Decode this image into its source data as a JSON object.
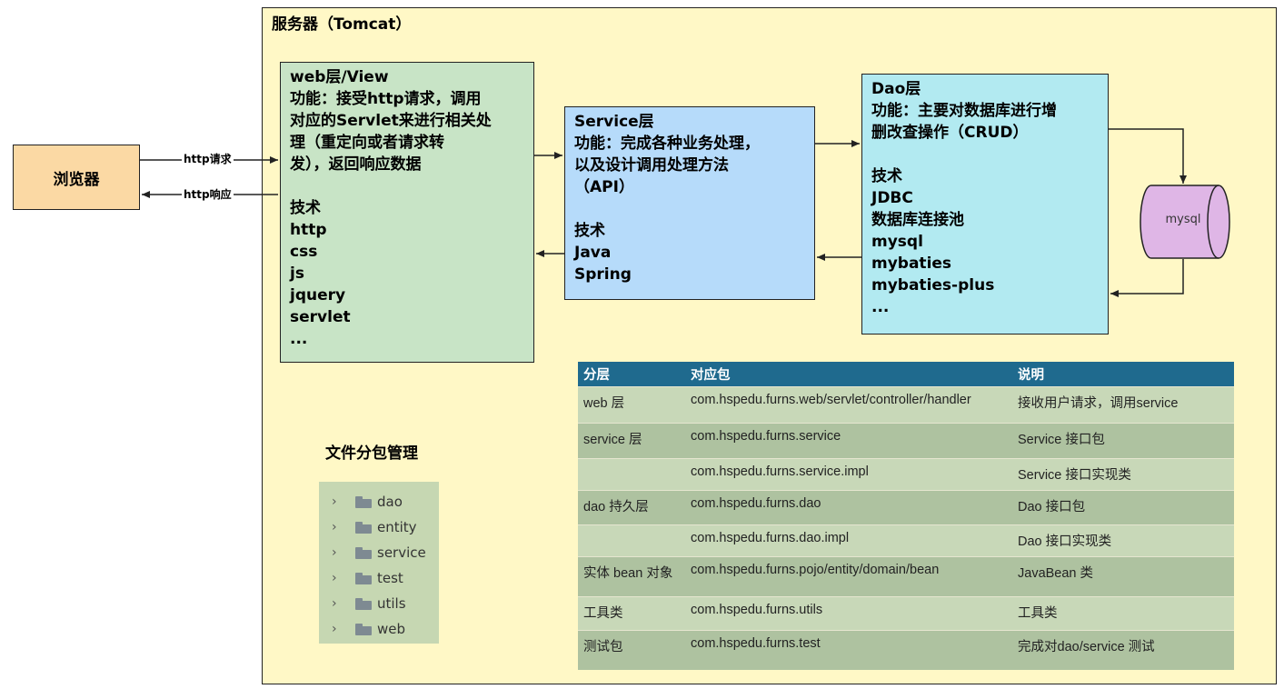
{
  "server": {
    "title": "服务器（Tomcat）"
  },
  "browser": {
    "label": "浏览器"
  },
  "arrows": {
    "http_request": "http请求",
    "http_response": "http响应"
  },
  "web_box": {
    "lines": [
      "web层/View",
      "功能：接受http请求，调用",
      "对应的Servlet来进行相关处",
      "理（重定向或者请求转",
      "发），返回响应数据",
      "",
      "技术",
      "http",
      "css",
      "js",
      "jquery",
      "servlet",
      "..."
    ]
  },
  "service_box": {
    "lines": [
      "Service层",
      "功能：完成各种业务处理，",
      "以及设计调用处理方法",
      "（API）",
      "",
      "技术",
      "Java",
      "Spring"
    ]
  },
  "dao_box": {
    "lines": [
      "Dao层",
      "功能：主要对数据库进行增",
      "删改查操作（CRUD）",
      "",
      "技术",
      "JDBC",
      "数据库连接池",
      "mysql",
      "mybaties",
      "mybaties-plus",
      "..."
    ]
  },
  "database": {
    "label": "mysql"
  },
  "package_section": {
    "title": "文件分包管理",
    "folders": [
      "dao",
      "entity",
      "service",
      "test",
      "utils",
      "web"
    ]
  },
  "table": {
    "headers": [
      "分层",
      "对应包",
      "说明"
    ],
    "rows": [
      [
        "web 层",
        "com.hspedu.furns.web/servlet/controller/handler",
        "接收用户请求，调用service"
      ],
      [
        "service 层",
        "com.hspedu.furns.service",
        "Service 接口包"
      ],
      [
        "",
        "com.hspedu.furns.service.impl",
        "Service 接口实现类"
      ],
      [
        "dao 持久层",
        "com.hspedu.furns.dao",
        "Dao 接口包"
      ],
      [
        "",
        "com.hspedu.furns.dao.impl",
        "Dao 接口实现类"
      ],
      [
        "实体 bean 对象",
        "com.hspedu.furns.pojo/entity/domain/bean",
        "JavaBean 类"
      ],
      [
        "工具类",
        "com.hspedu.furns.utils",
        "工具类"
      ],
      [
        "测试包",
        "com.hspedu.furns.test",
        "完成对dao/service 测试"
      ]
    ]
  }
}
